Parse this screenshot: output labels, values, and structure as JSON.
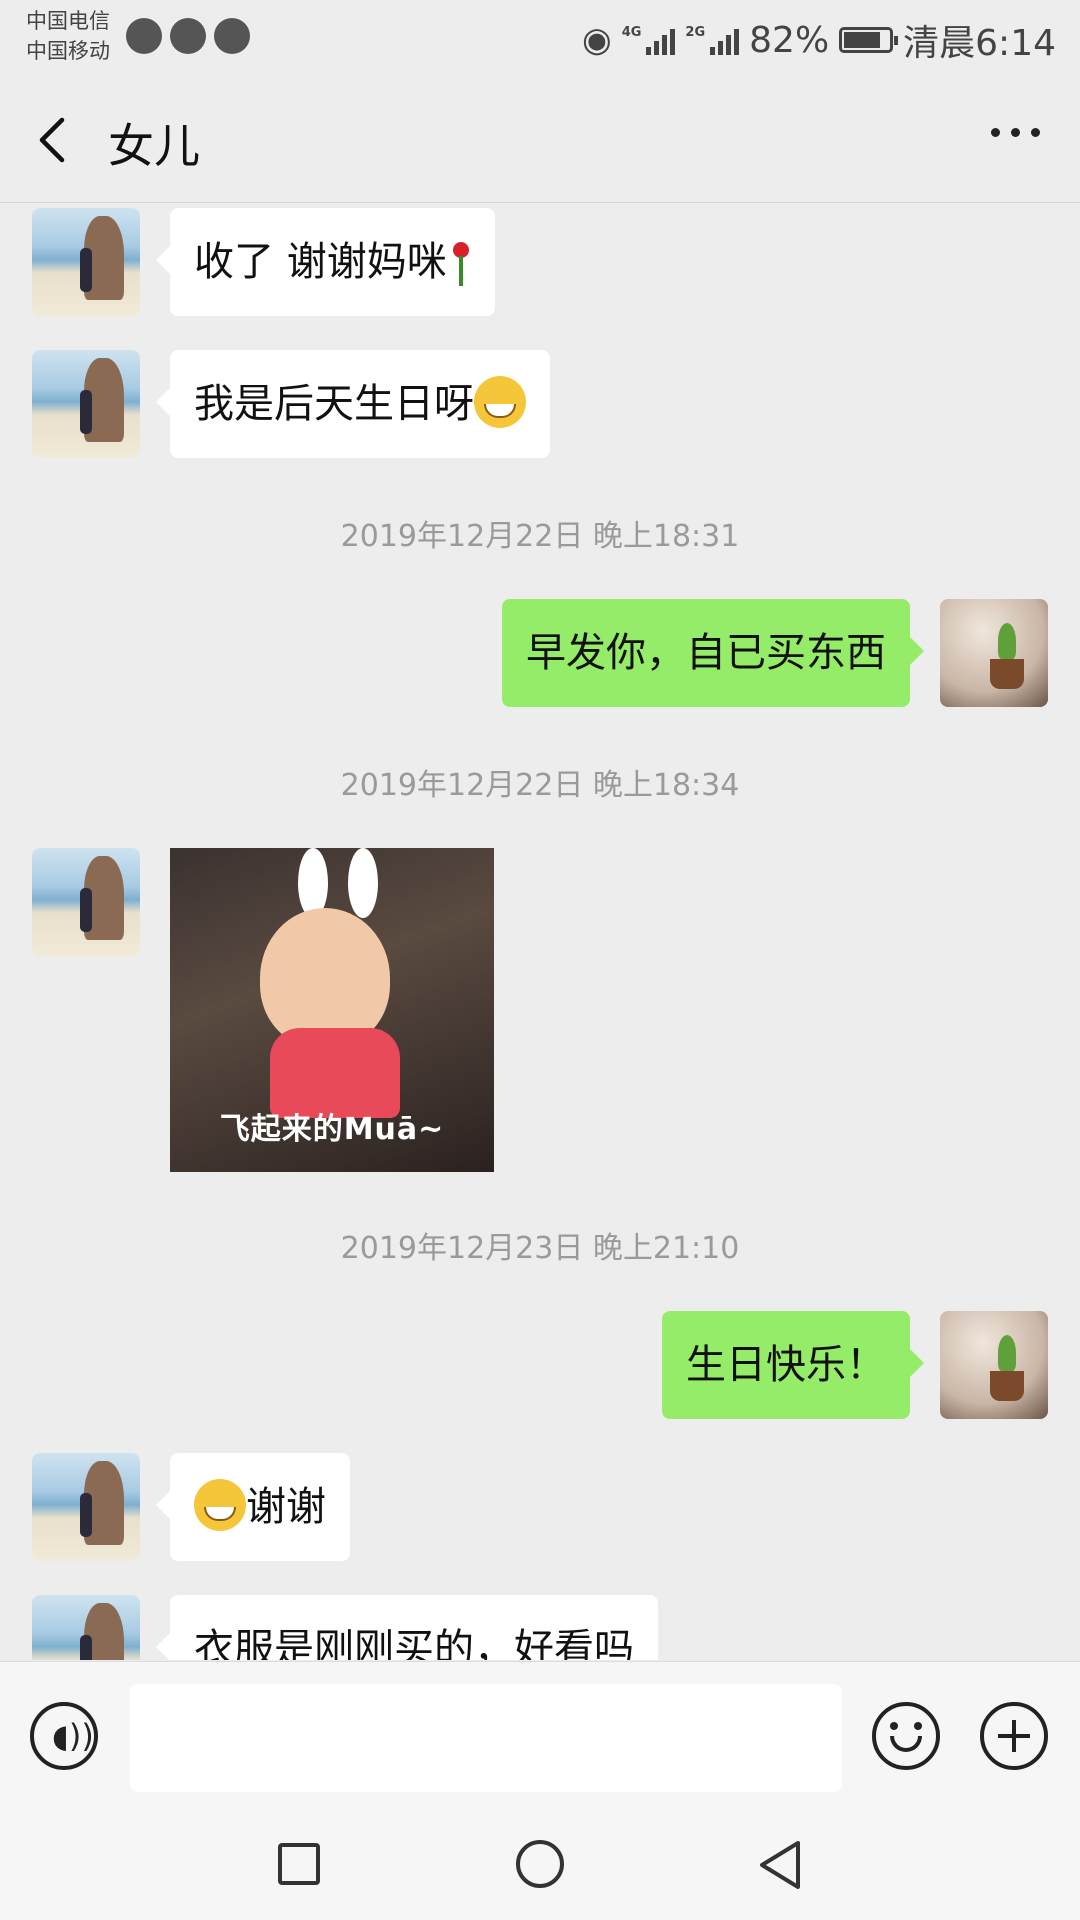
{
  "status_bar": {
    "carrier_1": "中国电信",
    "carrier_2": "中国移动",
    "network_1": "4G",
    "network_2": "2G",
    "battery": "82%",
    "battery_level": 0.82,
    "time": "清晨6:14"
  },
  "header": {
    "title": "女儿",
    "more_icon": "more-dots-icon"
  },
  "messages": [
    {
      "type": "text",
      "sender": "friend",
      "text": "收了 谢谢妈咪"
    },
    {
      "type": "text",
      "sender": "friend",
      "text": "我是后天生日呀"
    },
    {
      "type": "timestamp",
      "text": "2019年12月22日 晚上18:31"
    },
    {
      "type": "text",
      "sender": "me",
      "text": "早发你，自已买东西"
    },
    {
      "type": "timestamp",
      "text": "2019年12月22日 晚上18:34"
    },
    {
      "type": "image",
      "sender": "friend",
      "caption": "飞起来的Muā~"
    },
    {
      "type": "timestamp",
      "text": "2019年12月23日 晚上21:10"
    },
    {
      "type": "text",
      "sender": "me",
      "text": "生日快乐！"
    },
    {
      "type": "text",
      "sender": "friend",
      "text": "谢谢"
    },
    {
      "type": "text",
      "sender": "friend",
      "text": "衣服是刚刚买的，好看吗"
    }
  ],
  "input_bar": {
    "voice_icon": "voice-icon",
    "emoji_icon": "emoji-icon",
    "plus_icon": "plus-icon",
    "value": ""
  },
  "colors": {
    "background": "#ededed",
    "my_bubble": "#95ec69",
    "friend_bubble": "#ffffff",
    "timestamp": "#9a9a9a"
  }
}
